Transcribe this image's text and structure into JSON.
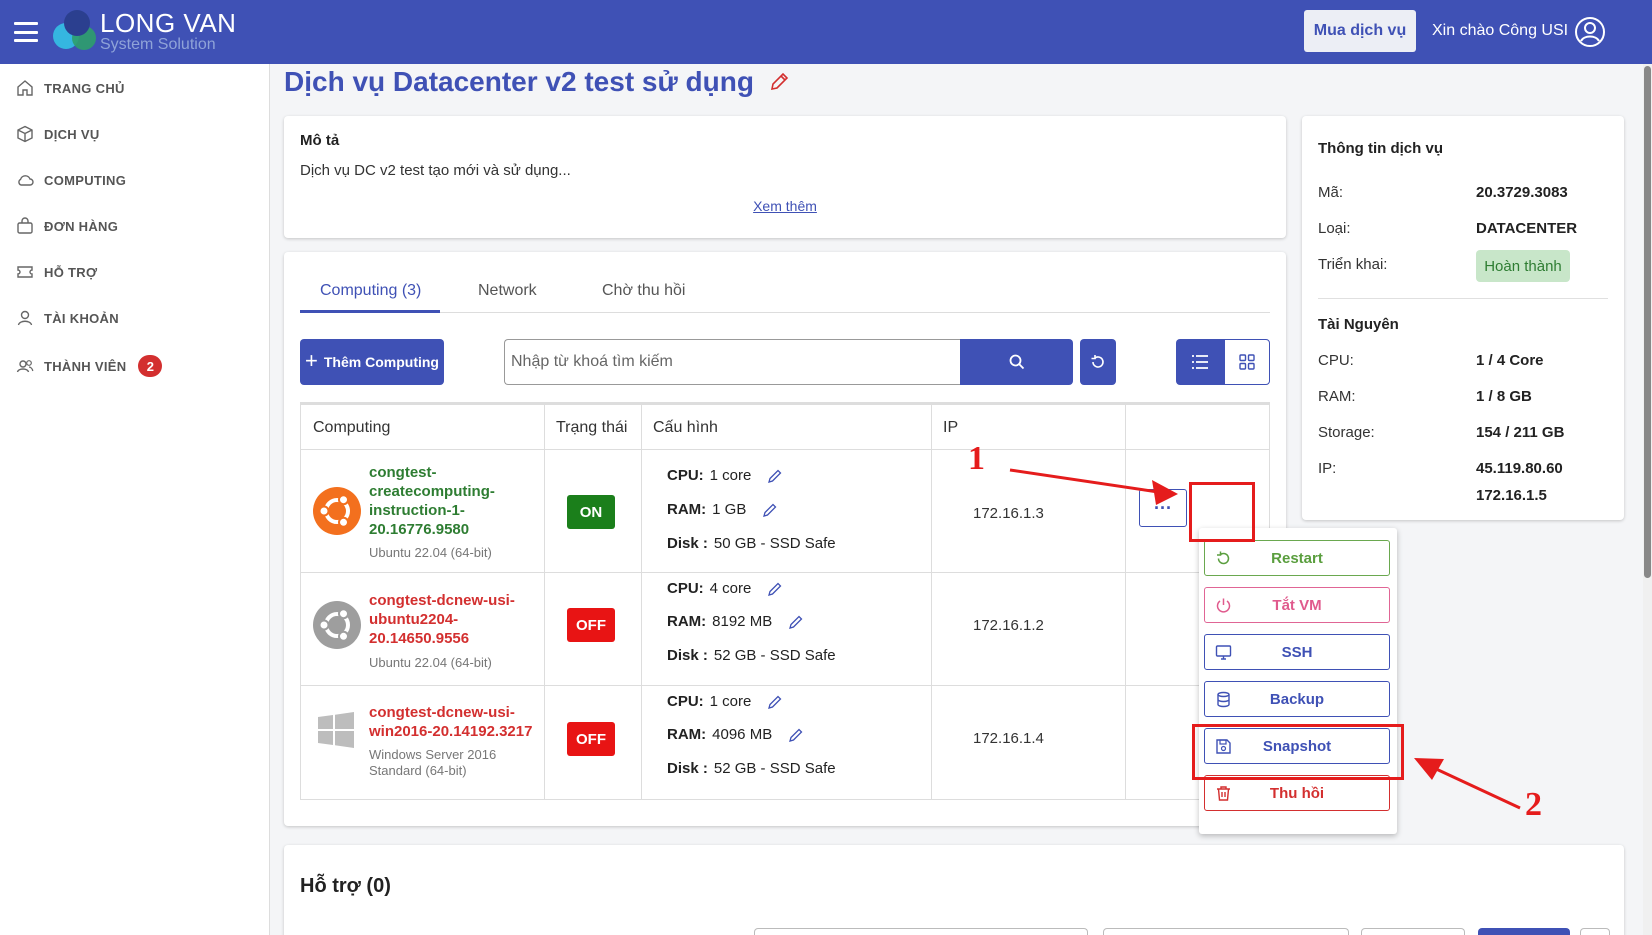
{
  "header": {
    "logo_line1": "LONG VAN",
    "logo_line2": "System Solution",
    "buy_button": "Mua dịch vụ",
    "greeting": "Xin chào Công USI",
    "brand_color": "#3f51b5"
  },
  "sidebar": {
    "items": [
      {
        "label": "TRANG CHỦ",
        "icon": "home-icon"
      },
      {
        "label": "DỊCH VỤ",
        "icon": "cube-icon"
      },
      {
        "label": "COMPUTING",
        "icon": "cloud-icon"
      },
      {
        "label": "ĐƠN HÀNG",
        "icon": "bag-icon"
      },
      {
        "label": "HỖ TRỢ",
        "icon": "ticket-icon"
      },
      {
        "label": "TÀI KHOẢN",
        "icon": "user-icon"
      },
      {
        "label": "THÀNH VIÊN",
        "icon": "users-icon",
        "badge": "2"
      }
    ]
  },
  "page": {
    "title": "Dịch vụ Datacenter v2 test sử dụng"
  },
  "description": {
    "heading": "Mô tả",
    "text": "Dịch vụ DC v2 test tạo mới và sử dụng...",
    "more_link": "Xem thêm"
  },
  "service_info": {
    "heading": "Thông tin dịch vụ",
    "code_label": "Mã:",
    "code_value": "20.3729.3083",
    "type_label": "Loại:",
    "type_value": "DATACENTER",
    "deploy_label": "Triển khai:",
    "deploy_value": "Hoàn thành",
    "resources_heading": "Tài Nguyên",
    "cpu_label": "CPU:",
    "cpu_value": "1 / 4 Core",
    "ram_label": "RAM:",
    "ram_value": "1 / 8 GB",
    "storage_label": "Storage:",
    "storage_value": "154 / 211 GB",
    "ip_label": "IP:",
    "ip_value_1": "45.119.80.60",
    "ip_value_2": "172.16.1.5"
  },
  "tabs": [
    {
      "label": "Computing (3)",
      "active": true
    },
    {
      "label": "Network",
      "active": false
    },
    {
      "label": "Chờ thu hồi",
      "active": false
    }
  ],
  "toolbar": {
    "add_label": "Thêm Computing",
    "search_placeholder": "Nhập từ khoá tìm kiếm"
  },
  "table": {
    "headers": [
      "Computing",
      "Trạng thái",
      "Cấu hình",
      "IP"
    ],
    "cpu_label": "CPU:",
    "ram_label": "RAM:",
    "disk_label": "Disk :",
    "rows": [
      {
        "name": "congtest-createcomputing-instruction-1-20.16776.9580",
        "os": "Ubuntu 22.04 (64-bit)",
        "status": "ON",
        "cpu": "1 core",
        "ram": "1 GB",
        "disk": "50 GB - SSD Safe",
        "ip": "172.16.1.3"
      },
      {
        "name": "congtest-dcnew-usi-ubuntu2204-20.14650.9556",
        "os": "Ubuntu 22.04 (64-bit)",
        "status": "OFF",
        "cpu": "4 core",
        "ram": "8192 MB",
        "disk": "52 GB - SSD Safe",
        "ip": "172.16.1.2"
      },
      {
        "name": "congtest-dcnew-usi-win2016-20.14192.3217",
        "os": "Windows Server 2016 Standard (64-bit)",
        "status": "OFF",
        "cpu": "1 core",
        "ram": "4096 MB",
        "disk": "52 GB - SSD Safe",
        "ip": "172.16.1.4"
      }
    ]
  },
  "action_menu": {
    "more_glyph": "···",
    "items": [
      {
        "label": "Restart",
        "icon": "restart-icon"
      },
      {
        "label": "Tắt VM",
        "icon": "power-icon"
      },
      {
        "label": "SSH",
        "icon": "monitor-icon"
      },
      {
        "label": "Backup",
        "icon": "database-icon"
      },
      {
        "label": "Snapshot",
        "icon": "save-icon"
      },
      {
        "label": "Thu hồi",
        "icon": "trash-icon"
      }
    ]
  },
  "annotations": {
    "step1": "1",
    "step2": "2",
    "color": "#e51c1c"
  },
  "support": {
    "heading": "Hỗ trợ (0)"
  }
}
